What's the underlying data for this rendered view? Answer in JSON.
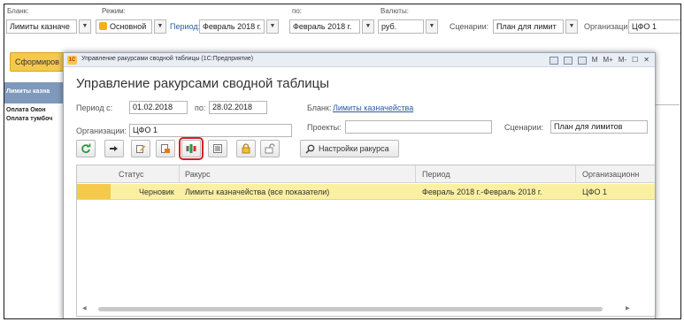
{
  "background": {
    "labels": {
      "blank": "Бланк:",
      "mode": "Режим:",
      "to": "по:",
      "currencies": "Валюты:"
    },
    "blank_value": "Лимиты казначе",
    "mode_value": "Основной",
    "period_label": "Период:",
    "period_value": "Февраль 2018 г.",
    "to_value": "Февраль 2018 г.",
    "currency_value": "руб.",
    "scenario_label": "Сценарии:",
    "scenario_value": "План для лимит",
    "organization_label": "Организации:",
    "organization_value": "ЦФО 1",
    "form_button": "Сформиров",
    "left_panel_header": "Лимиты казна",
    "left_items": [
      "Оплата Окон",
      "Оплата тумбоч"
    ]
  },
  "modal": {
    "window_title": "Управление ракурсами сводной таблицы (1С:Предприятие)",
    "heading": "Управление ракурсами сводной таблицы",
    "title_controls": [
      "M",
      "M+",
      "M-"
    ],
    "period_from_label": "Период с:",
    "period_from": "01.02.2018",
    "period_to_label": "по:",
    "period_to": "28.02.2018",
    "blank_label": "Бланк:",
    "blank_link": "Лимиты казначейства",
    "organizations_label": "Организации:",
    "organizations_value": "ЦФО 1",
    "projects_label": "Проекты:",
    "projects_value": "",
    "scenarios_label": "Сценарии:",
    "scenarios_value": "План для лимитов",
    "settings_button": "Настройки ракурса",
    "toolbar_icons": [
      "refresh-icon",
      "move-icon",
      "edit-icon",
      "copy-icon",
      "build-icon",
      "list-icon",
      "lock-icon",
      "unlock-icon",
      "search-icon"
    ],
    "table": {
      "columns": [
        "Статус",
        "Ракурс",
        "Период",
        "Организационн"
      ],
      "rows": [
        {
          "status": "Черновик",
          "view": "Лимиты казначейства (все показатели)",
          "period": "Февраль 2018 г.-Февраль 2018 г.",
          "org": "ЦФО 1"
        }
      ]
    }
  },
  "colors": {
    "accent_yellow": "#f5c94a",
    "selected_row": "#fbf0a2",
    "link": "#2b5aa6",
    "highlight_frame": "#d42020",
    "left_header": "#7e99bb"
  }
}
